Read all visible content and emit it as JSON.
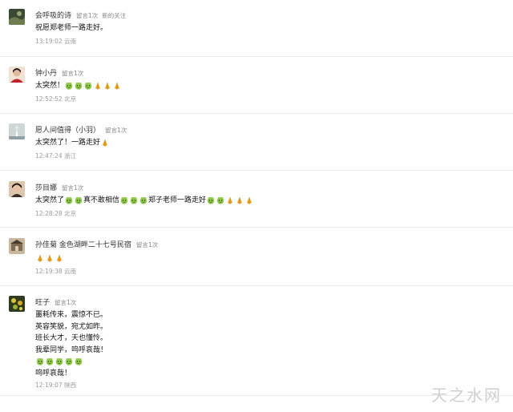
{
  "comments": [
    {
      "name": "会呼吸的诗",
      "tag": "留言1次",
      "tag2": "新的关注",
      "lines": [
        [
          "text:祝愿郑老师一路走好。"
        ]
      ],
      "time": "13:19:02 云南"
    },
    {
      "name": "钟小丹",
      "tag": "留言1次",
      "tag2": "",
      "lines": [
        [
          "text:太突然！",
          "face",
          "face",
          "face",
          "pray",
          "pray",
          "pray"
        ]
      ],
      "time": "12:52:52 北京"
    },
    {
      "name": "愿人间值得（小羽）",
      "tag": "留言1次",
      "tag2": "",
      "lines": [
        [
          "text:太突然了！一路走好",
          "pray"
        ]
      ],
      "time": "12:47:24 浙江"
    },
    {
      "name": "莎目娜",
      "tag": "留言1次",
      "tag2": "",
      "lines": [
        [
          "text:太突然了",
          "face",
          "face",
          "text:真不敢相信",
          "face",
          "face",
          "face",
          "text:郑子老师一路走好",
          "face",
          "face",
          "pray",
          "pray",
          "pray"
        ]
      ],
      "time": "12:28:28 北京"
    },
    {
      "name": "孙佳菊 金色湖畔二十七号民宿",
      "tag": "留言1次",
      "tag2": "",
      "lines": [
        [
          "pray",
          "pray",
          "pray"
        ]
      ],
      "time": "12:19:38 云南"
    },
    {
      "name": "旺子",
      "tag": "留言1次",
      "tag2": "",
      "lines": [
        [
          "text:噩耗传来，震惊不已。"
        ],
        [
          "text:英容笑貌，宛尤如昨。"
        ],
        [
          "text:班长大才，天也懂怜。"
        ],
        [
          "text:我辈同学，呜呼哀哉！"
        ],
        [
          "face",
          "face",
          "face",
          "face",
          "face"
        ],
        [
          "text:呜呼哀哉！"
        ]
      ],
      "time": "12:19:07 陕西"
    }
  ],
  "watermark": "天之水网",
  "colors": {
    "face": "#8fc94a",
    "pray": "#e8a321",
    "divider": "#ececec"
  },
  "icons": {
    "face": "face-emoji-icon",
    "pray": "pray-emoji-icon"
  }
}
